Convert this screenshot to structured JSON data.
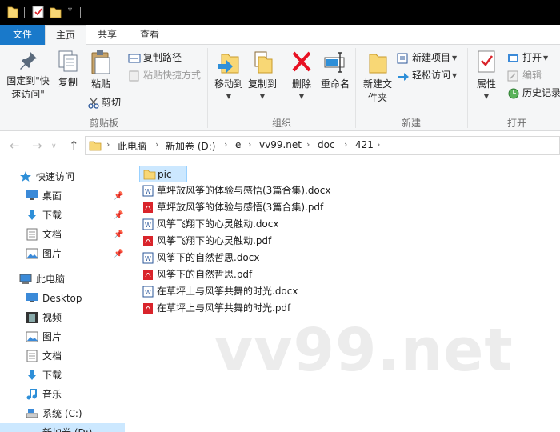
{
  "tabs": {
    "file": "文件",
    "home": "主页",
    "share": "共享",
    "view": "查看"
  },
  "ribbon": {
    "clipboard": {
      "pin_quick_access": "固定到\"快速访问\"",
      "copy": "复制",
      "paste": "粘贴",
      "copy_path": "复制路径",
      "paste_shortcut": "粘贴快捷方式",
      "cut": "剪切",
      "group_label": "剪贴板"
    },
    "organize": {
      "move_to": "移动到",
      "copy_to": "复制到",
      "delete": "删除",
      "rename": "重命名",
      "group_label": "组织"
    },
    "new": {
      "new_folder": "新建文件夹",
      "new_item": "新建项目",
      "easy_access": "轻松访问",
      "group_label": "新建"
    },
    "open": {
      "properties": "属性",
      "open": "打开",
      "edit": "编辑",
      "history": "历史记录",
      "group_label": "打开"
    }
  },
  "address": {
    "crumbs": [
      "此电脑",
      "新加卷 (D:)",
      "e",
      "vv99.net",
      "doc",
      "421"
    ]
  },
  "nav": {
    "items": [
      {
        "label": "快速访问",
        "icon": "star-icon"
      },
      {
        "label": "桌面",
        "icon": "desktop-icon",
        "pinned": true
      },
      {
        "label": "下载",
        "icon": "download-icon",
        "pinned": true
      },
      {
        "label": "文档",
        "icon": "document-icon",
        "pinned": true
      },
      {
        "label": "图片",
        "icon": "picture-icon",
        "pinned": true
      },
      {
        "label": "此电脑",
        "icon": "computer-icon"
      },
      {
        "label": "Desktop",
        "icon": "desktop-icon"
      },
      {
        "label": "视频",
        "icon": "video-icon"
      },
      {
        "label": "图片",
        "icon": "picture-icon"
      },
      {
        "label": "文档",
        "icon": "document-icon"
      },
      {
        "label": "下载",
        "icon": "download-icon"
      },
      {
        "label": "音乐",
        "icon": "music-icon"
      },
      {
        "label": "系统 (C:)",
        "icon": "drive-icon"
      },
      {
        "label": "新加卷 (D:)",
        "icon": "drive-icon"
      }
    ]
  },
  "files": [
    {
      "name": "pic",
      "type": "folder"
    },
    {
      "name": "草坪放风筝的体验与感悟(3篇合集).docx",
      "type": "docx"
    },
    {
      "name": "草坪放风筝的体验与感悟(3篇合集).pdf",
      "type": "pdf"
    },
    {
      "name": "风筝飞翔下的心灵触动.docx",
      "type": "docx"
    },
    {
      "name": "风筝飞翔下的心灵触动.pdf",
      "type": "pdf"
    },
    {
      "name": "风筝下的自然哲思.docx",
      "type": "docx"
    },
    {
      "name": "风筝下的自然哲思.pdf",
      "type": "pdf"
    },
    {
      "name": "在草坪上与风筝共舞的时光.docx",
      "type": "docx"
    },
    {
      "name": "在草坪上与风筝共舞的时光.pdf",
      "type": "pdf"
    }
  ],
  "watermark": "vv99.net",
  "colors": {
    "accent": "#1979ca",
    "selection": "#cce8ff",
    "folder": "#f8d775",
    "pdf": "#d9242b",
    "word": "#2b579a",
    "delete": "#e81123"
  }
}
